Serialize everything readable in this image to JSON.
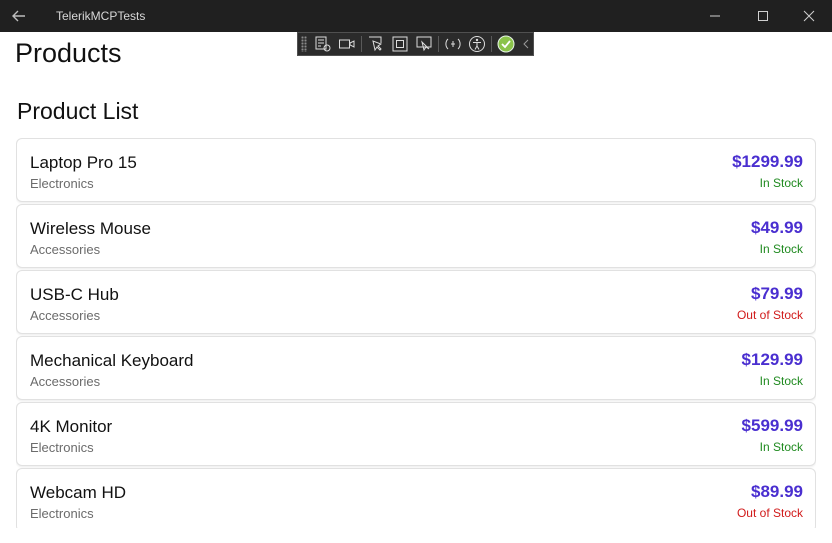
{
  "window": {
    "title": "TelerikMCPTests"
  },
  "titlebar_icons": [
    "back-arrow-icon",
    "minimize-icon",
    "maximize-icon",
    "close-icon"
  ],
  "debug_toolbar": {
    "tools": [
      "select-element-icon",
      "record-icon",
      "element-picker-icon",
      "display-layout-icon",
      "track-focus-icon",
      "hot-reload-icon",
      "accessibility-icon",
      "checkmark-icon",
      "collapse-icon"
    ]
  },
  "page": {
    "title": "Products",
    "section_title": "Product List"
  },
  "colors": {
    "price": "#4a2fd0",
    "in_stock": "#1f8a1f",
    "out_of_stock": "#d11a1a",
    "titlebar": "#202020"
  },
  "products": [
    {
      "name": "Laptop Pro 15",
      "category": "Electronics",
      "price": "$1299.99",
      "stock": "In Stock"
    },
    {
      "name": "Wireless Mouse",
      "category": "Accessories",
      "price": "$49.99",
      "stock": "In Stock"
    },
    {
      "name": "USB-C Hub",
      "category": "Accessories",
      "price": "$79.99",
      "stock": "Out of Stock"
    },
    {
      "name": "Mechanical Keyboard",
      "category": "Accessories",
      "price": "$129.99",
      "stock": "In Stock"
    },
    {
      "name": "4K Monitor",
      "category": "Electronics",
      "price": "$599.99",
      "stock": "In Stock"
    },
    {
      "name": "Webcam HD",
      "category": "Electronics",
      "price": "$89.99",
      "stock": "Out of Stock"
    }
  ]
}
